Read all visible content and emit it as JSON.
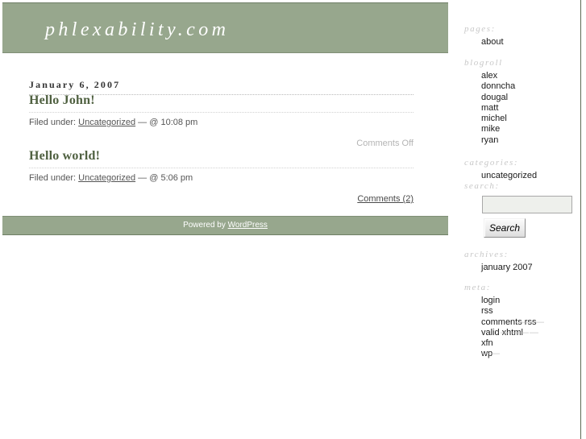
{
  "site": {
    "title": "phlexability.com"
  },
  "content": {
    "date_heading": "January 6, 2007",
    "posts": [
      {
        "title": "Hello John!",
        "filed_under_label": "Filed under:",
        "category": "Uncategorized",
        "separator": "— @",
        "time": "10:08 pm",
        "comments": "Comments Off",
        "comments_is_link": false
      },
      {
        "title": "Hello world!",
        "filed_under_label": "Filed under:",
        "category": "Uncategorized",
        "separator": "— @",
        "time": "5:06 pm",
        "comments": "Comments (2)",
        "comments_is_link": true
      }
    ]
  },
  "footer": {
    "powered_by": "Powered by",
    "platform": "WordPress"
  },
  "sidebar": {
    "pages": {
      "heading": "pages:",
      "items": [
        "about"
      ]
    },
    "blogroll": {
      "heading": "blogroll",
      "items": [
        "alex",
        "donncha",
        "dougal",
        "matt",
        "michel",
        "mike",
        "ryan"
      ]
    },
    "categories": {
      "heading": "categories:",
      "items": [
        "uncategorized"
      ]
    },
    "search": {
      "heading": "search:",
      "value": "",
      "placeholder": "",
      "button_label": "Search"
    },
    "archives": {
      "heading": "archives:",
      "items": [
        "january 2007"
      ]
    },
    "meta": {
      "heading": "meta:",
      "items": [
        "login",
        "rss",
        "comments rss",
        "valid xhtml",
        "xfn",
        "wp"
      ]
    }
  },
  "colors": {
    "accent_green": "#97a78d",
    "post_title": "#4f6040",
    "heading_gray": "#c8c8c8",
    "frame_border": "#5c6b55"
  }
}
